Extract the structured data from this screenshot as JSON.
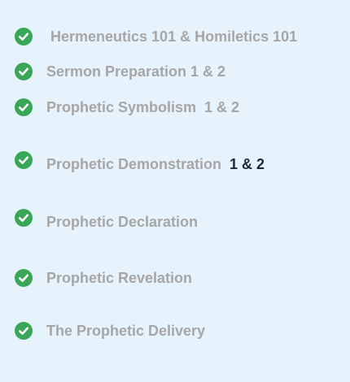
{
  "theme": {
    "check_color": "#3aa657",
    "label_color": "#a6a6a6",
    "suffix_color": "#1f2933",
    "background": "#e6f3fc"
  },
  "courses": [
    {
      "label": " Hermeneutics 101 & Homiletics 101",
      "suffix": "",
      "icon": "check-circle-icon"
    },
    {
      "label": "Sermon Preparation 1 & 2",
      "suffix": "",
      "icon": "check-circle-icon"
    },
    {
      "label": "Prophetic Symbolism  1 & 2",
      "suffix": "",
      "icon": "check-circle-icon"
    },
    {
      "label": "Prophetic Demonstration  ",
      "suffix": "1 & 2",
      "icon": "check-circle-icon"
    },
    {
      "label": "Prophetic Declaration",
      "suffix": "",
      "icon": "check-circle-icon"
    },
    {
      "label": "Prophetic Revelation",
      "suffix": "",
      "icon": "check-circle-icon"
    },
    {
      "label": "The Prophetic Delivery",
      "suffix": "",
      "icon": "check-circle-icon"
    }
  ]
}
